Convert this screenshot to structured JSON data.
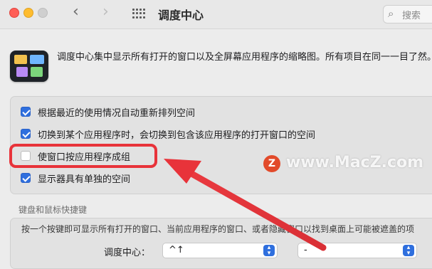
{
  "window": {
    "title": "调度中心",
    "search_placeholder": "搜索",
    "back_icon": "chevron-left-icon",
    "forward_icon": "chevron-right-icon",
    "grid_icon": "show-all-grid-icon"
  },
  "description": "调度中心集中显示所有打开的窗口以及全屏幕应用程序的缩略图。所有项目在同一一目了然。",
  "options": [
    {
      "label": "根据最近的使用情况自动重新排列空间",
      "checked": true
    },
    {
      "label": "切换到某个应用程序时，会切换到包含该应用程序的打开窗口的空间",
      "checked": true
    },
    {
      "label": "使窗口按应用程序成组",
      "checked": false,
      "highlighted": true
    },
    {
      "label": "显示器具有单独的空间",
      "checked": true
    }
  ],
  "shortcuts": {
    "section_title": "键盘和鼠标快捷键",
    "hint": "按一个按键即可显示所有打开的窗口、当前应用程序的窗口、或者隐藏窗口以找到桌面上可能被遮盖的项",
    "row_label": "调度中心：",
    "keyboard_value": "^↑",
    "mouse_value": "-"
  },
  "watermark": {
    "logo": "Z",
    "text": "www.MacZ.com"
  },
  "colors": {
    "accent": "#2f6fde",
    "annotation_red": "#e8333a",
    "close": "#ff5f57",
    "minimize": "#febc2e"
  }
}
